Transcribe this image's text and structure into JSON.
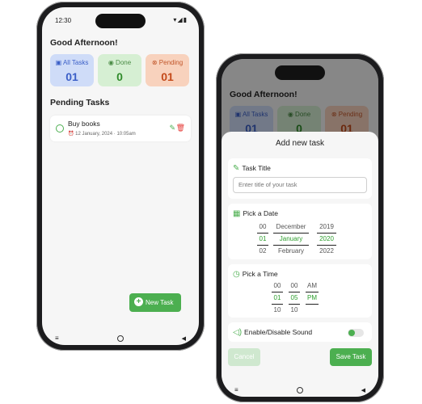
{
  "phone1": {
    "status_time": "12:30",
    "status_icons": "▾◢▮",
    "greeting": "Good Afternoon!",
    "cards": [
      {
        "label": "All Tasks",
        "count": "01",
        "icon": "list-icon"
      },
      {
        "label": "Done",
        "count": "0",
        "icon": "check-circle-icon"
      },
      {
        "label": "Pending",
        "count": "01",
        "icon": "clock-icon"
      }
    ],
    "section_title": "Pending Tasks",
    "task": {
      "title": "Buy books",
      "date": "12 January, 2024",
      "time": "10:05am"
    },
    "fab_label": "New Task",
    "nav": {
      "menu": "≡",
      "back": "◀"
    }
  },
  "phone2": {
    "greeting": "Good Afternoon!",
    "cards": [
      {
        "label": "All Tasks",
        "count": "01"
      },
      {
        "label": "Done",
        "count": "0"
      },
      {
        "label": "Pending",
        "count": "01"
      }
    ],
    "sheet_title": "Add new task",
    "task_title_label": "Task Title",
    "task_title_placeholder": "Enter title of your task",
    "date_label": "Pick a Date",
    "date_wheel": {
      "day": [
        "00",
        "01",
        "02"
      ],
      "month": [
        "December",
        "January",
        "February"
      ],
      "year": [
        "2019",
        "2020",
        "2022"
      ]
    },
    "time_label": "Pick a Time",
    "time_wheel": {
      "hour": [
        "00",
        "01",
        "10"
      ],
      "minute": [
        "00",
        "05",
        "10"
      ],
      "ampm": [
        "AM",
        "PM",
        ""
      ]
    },
    "sound_label": "Enable/Disable Sound",
    "sound_enabled": true,
    "cancel_label": "Cancel",
    "save_label": "Save Task",
    "nav": {
      "menu": "≡",
      "back": "◀"
    }
  },
  "colors": {
    "accent": "#4caf50",
    "blue": "#3b5fc7",
    "orange": "#c44a1a",
    "delete": "#e53935"
  }
}
